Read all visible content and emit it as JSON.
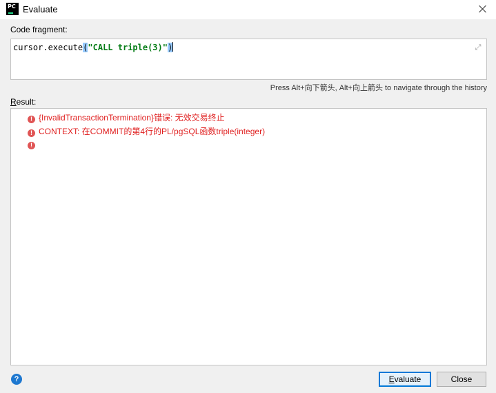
{
  "window": {
    "title": "Evaluate",
    "icon_name": "pycharm-app-icon",
    "icon_letters": "PC"
  },
  "code": {
    "label": "Code fragment:",
    "prefix": "cursor.execute",
    "open_paren": "(",
    "string": "\"CALL triple(3)\"",
    "close_paren": ")",
    "hint": "Press Alt+向下箭头, Alt+向上箭头 to navigate through the history"
  },
  "result": {
    "label_first": "R",
    "label_rest": "esult:",
    "rows": [
      {
        "icon": "error-icon",
        "text": "{InvalidTransactionTermination}错误:  无效交易终止"
      },
      {
        "icon": "error-icon",
        "text": "CONTEXT:  在COMMIT的第4行的PL/pgSQL函数triple(integer)"
      },
      {
        "icon": "error-icon",
        "text": ""
      }
    ]
  },
  "buttons": {
    "evaluate_first": "E",
    "evaluate_rest": "valuate",
    "close": "Close",
    "help": "?"
  },
  "colors": {
    "error": "#e02020",
    "accent": "#0078d7",
    "string": "#067d17"
  }
}
